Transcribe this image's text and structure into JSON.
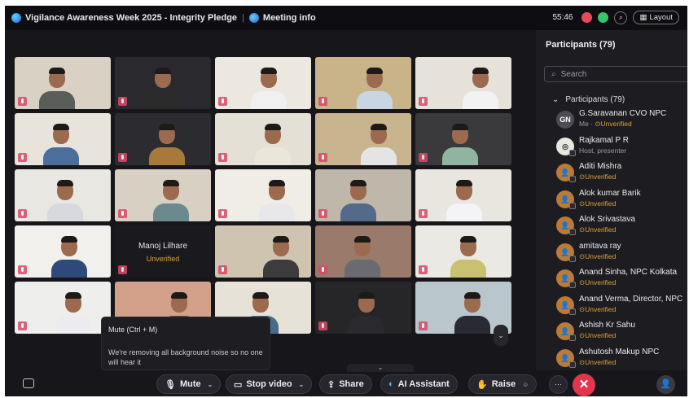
{
  "window": {
    "meeting_title": "Vigilance Awareness Week 2025 - Integrity Pledge",
    "meeting_info_label": "Meeting info",
    "timer": "55:46",
    "layout_label": "Layout"
  },
  "grid": {
    "tiles": [
      {
        "type": "video"
      },
      {
        "type": "video"
      },
      {
        "type": "video"
      },
      {
        "type": "video"
      },
      {
        "type": "video"
      },
      {
        "type": "video"
      },
      {
        "type": "video"
      },
      {
        "type": "video"
      },
      {
        "type": "video"
      },
      {
        "type": "video"
      },
      {
        "type": "video"
      },
      {
        "type": "video"
      },
      {
        "type": "video"
      },
      {
        "type": "video"
      },
      {
        "type": "video"
      },
      {
        "type": "video"
      },
      {
        "type": "name",
        "name": "Manoj Lilhare",
        "status": "Unverified"
      },
      {
        "type": "video"
      },
      {
        "type": "video"
      },
      {
        "type": "video"
      },
      {
        "type": "video"
      },
      {
        "type": "video"
      },
      {
        "type": "video"
      },
      {
        "type": "video"
      },
      {
        "type": "video"
      }
    ]
  },
  "tooltip": {
    "title": "Mute  (Ctrl + M)",
    "body": "We're removing all background noise so no one will hear it"
  },
  "toolbar": {
    "mute_label": "Mute",
    "stop_video_label": "Stop video",
    "share_label": "Share",
    "ai_assistant_label": "AI Assistant",
    "raise_label": "Raise"
  },
  "participants_panel": {
    "heading": "Participants (79)",
    "search_placeholder": "Search",
    "group_label": "Participants (79)",
    "items": [
      {
        "name": "G.Saravanan CVO NPC",
        "sub_prefix": "Me · ",
        "status": "Unverified",
        "initials": "GN"
      },
      {
        "name": "Rajkamal P R",
        "sub_prefix": "Host, presenter",
        "status": "",
        "initials": ""
      },
      {
        "name": "Aditi Mishra",
        "sub_prefix": "",
        "status": "Unverified",
        "initials": ""
      },
      {
        "name": "Alok kumar Barik",
        "sub_prefix": "",
        "status": "Unverified",
        "initials": ""
      },
      {
        "name": "Alok Srivastava",
        "sub_prefix": "",
        "status": "Unverified",
        "initials": ""
      },
      {
        "name": "amitava ray",
        "sub_prefix": "",
        "status": "Unverified",
        "initials": ""
      },
      {
        "name": "Anand Sinha, NPC Kolkata",
        "sub_prefix": "",
        "status": "Unverified",
        "initials": ""
      },
      {
        "name": "Anand Verma, Director, NPC",
        "sub_prefix": "",
        "status": "Unverified",
        "initials": ""
      },
      {
        "name": "Ashish Kr Sahu",
        "sub_prefix": "",
        "status": "Unverified",
        "initials": ""
      },
      {
        "name": "Ashutosh Makup NPC",
        "sub_prefix": "",
        "status": "Unverified",
        "initials": ""
      }
    ]
  },
  "colors": {
    "end_call": "#e3364d",
    "unverified": "#d9a23a",
    "background": "#17171b"
  }
}
